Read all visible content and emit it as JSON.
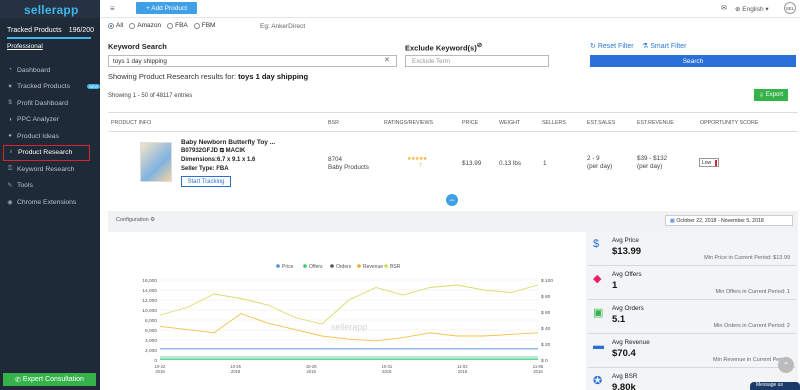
{
  "sidebar": {
    "logo": "sellerapp",
    "tracked_label": "Tracked Products",
    "tracked_count": "196/200",
    "tracked_fraction": 0.98,
    "plan": "Professional",
    "items": [
      {
        "label": "Dashboard",
        "icon": "gauge-icon"
      },
      {
        "label": "Tracked Products",
        "icon": "heart-icon",
        "badge": "NEW"
      },
      {
        "label": "Profit Dashboard",
        "icon": "dollar-icon"
      },
      {
        "label": "PPC Analyzer",
        "icon": "gauge-icon"
      },
      {
        "label": "Product Ideas",
        "icon": "bulb-icon"
      },
      {
        "label": "Product Research",
        "icon": "search-icon",
        "active": true
      },
      {
        "label": "Keyword Research",
        "icon": "key-icon"
      },
      {
        "label": "Tools",
        "icon": "wrench-icon"
      },
      {
        "label": "Chrome Extensions",
        "icon": "chrome-icon"
      }
    ],
    "expert_button": "Expert Consultation"
  },
  "topbar": {
    "add_product": "+ Add Product",
    "language": "English",
    "avatar": "SEL"
  },
  "filters": {
    "options": [
      "All",
      "Amazon",
      "FBA",
      "FBM"
    ],
    "selected": "All",
    "eg_text": "Eg: AnkerDirect"
  },
  "search": {
    "keyword_label": "Keyword Search",
    "keyword_value": "toys 1 day shipping",
    "exclude_label": "Exclude Keyword(s)",
    "exclude_placeholder": "Exclude Term",
    "reset_filter": "Reset Filter",
    "smart_filter": "Smart Filter",
    "search_button": "Search"
  },
  "results": {
    "showing_prefix": "Showing Product Research results for: ",
    "showing_term": "toys 1 day shipping",
    "entries": "Showing 1 - 50 of 48117 entries",
    "export": "Export"
  },
  "table": {
    "headers": [
      "PRODUCT INFO",
      "BSR",
      "RATINGS/REVIEWS",
      "PRICE",
      "WEIGHT",
      "SELLERS",
      "EST.SALES",
      "EST.REVENUE",
      "OPPORTUNITY SCORE"
    ],
    "row": {
      "title": "Baby Newborn Butterfly Toy ...",
      "asin": "B07932GFJD",
      "brand": "MACIK",
      "dimensions": "Dimensions:6.7 x 9.1 x 1.6",
      "seller_type": "Seller Type: FBA",
      "track_button": "Start Tracking",
      "bsr": "8704",
      "bsr_category": "Baby Products",
      "stars": "★★★★★",
      "reviews": "7",
      "price": "$13.99",
      "weight": "0.13 lbs",
      "sellers": "1",
      "sales": "2 - 9",
      "sales_unit": "(per day)",
      "revenue": "$39 - $132",
      "revenue_unit": "(per day)",
      "score": "Low"
    }
  },
  "panel": {
    "config_label": "Configuration",
    "date_range": "October 22, 2018 - November 5, 2018",
    "watermark": "sellerapp"
  },
  "chart_data": {
    "type": "line",
    "legend": [
      "Price",
      "Offers",
      "Orders",
      "Revenue",
      "BSR"
    ],
    "legend_colors": [
      "#4a90e2",
      "#2ecc71",
      "#555555",
      "#f5a623",
      "#d4d84a"
    ],
    "y_left_ticks": [
      "16,000",
      "14,000",
      "12,000",
      "10,000",
      "8,000",
      "6,000",
      "4,000",
      "2,000",
      "0"
    ],
    "y_right_ticks": [
      "$ 100",
      "$ 80",
      "$ 60",
      "$ 40",
      "$ 20",
      "$ 0"
    ],
    "x_ticks_top": [
      "10-22",
      "10-25",
      "10-28",
      "10-31",
      "11-02",
      "11-05"
    ],
    "x_ticks_bottom": [
      "2018",
      "2018",
      "2018",
      "2018",
      "2018",
      "2018"
    ],
    "x": [
      0,
      1,
      2,
      3,
      4,
      5,
      6,
      7,
      8,
      9,
      10,
      11,
      12,
      13,
      14
    ],
    "series": [
      {
        "name": "BSR",
        "values": [
          9000,
          10500,
          13200,
          12300,
          11000,
          8500,
          7200,
          12000,
          14500,
          13000,
          14500,
          15000,
          14000,
          13500,
          15000
        ]
      },
      {
        "name": "Revenue",
        "values": [
          42,
          38,
          34,
          58,
          46,
          38,
          30,
          26,
          24,
          28,
          34,
          30,
          30,
          32,
          34
        ]
      },
      {
        "name": "Price",
        "values": [
          14,
          14,
          14,
          14,
          14,
          14,
          14,
          14,
          14,
          14,
          14,
          14,
          14,
          14,
          14
        ]
      },
      {
        "name": "Offers",
        "values": [
          1,
          1,
          1,
          1,
          1,
          1,
          1,
          1,
          1,
          1,
          1,
          1,
          1,
          1,
          1
        ]
      }
    ]
  },
  "stats": [
    {
      "title": "Avg Price",
      "value": "$13.99",
      "min": "Min Price in Current Period: $13.99",
      "icon": "dollar-icon",
      "color": "#2a70d8"
    },
    {
      "title": "Avg Offers",
      "value": "1",
      "min": "Min Offers in Current Period: 1",
      "icon": "tag-icon",
      "color": "#e91e63"
    },
    {
      "title": "Avg Orders",
      "value": "5.1",
      "min": "Min Orders in Current Period: 2",
      "icon": "cart-icon",
      "color": "#36b24a"
    },
    {
      "title": "Avg Revenue",
      "value": "$70.4",
      "min": "Min Revenue in Current Period: ",
      "icon": "card-icon",
      "color": "#2a70d8"
    },
    {
      "title": "Avg BSR",
      "value": "9.80k",
      "min": "",
      "icon": "medal-icon",
      "color": "#2a70d8"
    }
  ],
  "chat": "Message us"
}
